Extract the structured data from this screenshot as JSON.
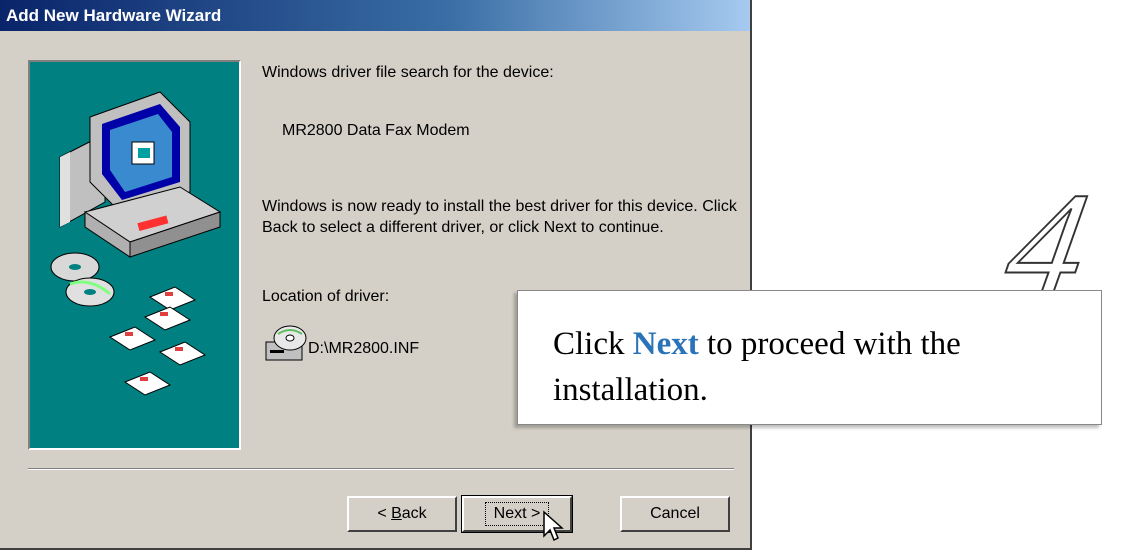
{
  "window": {
    "title": "Add New Hardware Wizard"
  },
  "content": {
    "search_heading": "Windows driver file search for the device:",
    "device_name": "MR2800 Data Fax Modem",
    "ready_message": "Windows is now ready to install the best driver for this device. Click Back to select a different driver, or click Next to continue.",
    "location_label": "Location of driver:",
    "driver_path": "D:\\MR2800.INF"
  },
  "buttons": {
    "back_prefix": "< ",
    "back_hotkey": "B",
    "back_rest": "ack",
    "next_label": "Next >",
    "cancel_label": "Cancel"
  },
  "callout": {
    "prefix": "Click",
    "highlight": "Next",
    "suffix": "to proceed with the installation."
  },
  "step_number": "4",
  "colors": {
    "highlight": "#2a73b8",
    "art_background": "#008080",
    "window_face": "#d4d0c8"
  }
}
